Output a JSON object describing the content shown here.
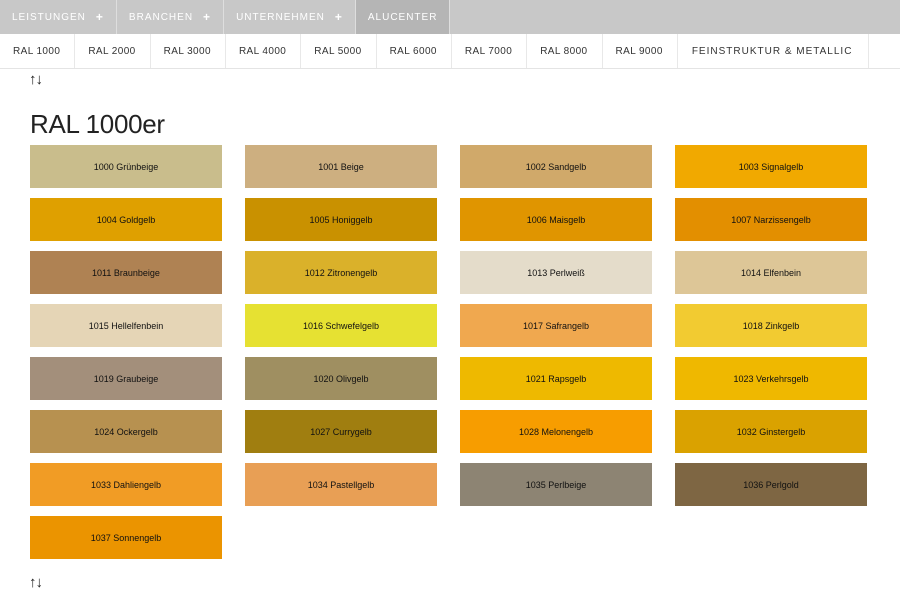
{
  "topnav": [
    {
      "label": "LEISTUNGEN",
      "has_plus": true
    },
    {
      "label": "BRANCHEN",
      "has_plus": true
    },
    {
      "label": "UNTERNEHMEN",
      "has_plus": true
    },
    {
      "label": "ALUCENTER",
      "has_plus": false
    }
  ],
  "plus_symbol": "+",
  "subnav": [
    "RAL 1000",
    "RAL 2000",
    "RAL 3000",
    "RAL 4000",
    "RAL 5000",
    "RAL 6000",
    "RAL 7000",
    "RAL 8000",
    "RAL 9000",
    "FEINSTRUKTUR & METALLIC"
  ],
  "arrows_text": "↑↓",
  "section_title": "RAL 1000er",
  "swatches": [
    {
      "label": "1000 Grünbeige",
      "color": "#C9BD8C"
    },
    {
      "label": "1001 Beige",
      "color": "#CDAF80"
    },
    {
      "label": "1002 Sandgelb",
      "color": "#D0A96A"
    },
    {
      "label": "1003 Signalgelb",
      "color": "#F1A900"
    },
    {
      "label": "1004 Goldgelb",
      "color": "#DFA000"
    },
    {
      "label": "1005 Honiggelb",
      "color": "#C99100"
    },
    {
      "label": "1006 Maisgelb",
      "color": "#E09500"
    },
    {
      "label": "1007 Narzissengelb",
      "color": "#E38F00"
    },
    {
      "label": "1011 Braunbeige",
      "color": "#AF8253"
    },
    {
      "label": "1012 Zitronengelb",
      "color": "#DAB12A"
    },
    {
      "label": "1013 Perlweiß",
      "color": "#E4DCCA"
    },
    {
      "label": "1014 Elfenbein",
      "color": "#DDC697"
    },
    {
      "label": "1015 Hellelfenbein",
      "color": "#E5D5B6"
    },
    {
      "label": "1016 Schwefelgelb",
      "color": "#E6E132"
    },
    {
      "label": "1017 Safrangelb",
      "color": "#F0A84F"
    },
    {
      "label": "1018 Zinkgelb",
      "color": "#F2CB31"
    },
    {
      "label": "1019 Graubeige",
      "color": "#A38F7B"
    },
    {
      "label": "1020 Olivgelb",
      "color": "#9F8F61"
    },
    {
      "label": "1021 Rapsgelb",
      "color": "#EEB900"
    },
    {
      "label": "1023 Verkehrsgelb",
      "color": "#EFB800"
    },
    {
      "label": "1024 Ockergelb",
      "color": "#B79150"
    },
    {
      "label": "1027 Currygelb",
      "color": "#A07E10"
    },
    {
      "label": "1028 Melonengelb",
      "color": "#F79D00"
    },
    {
      "label": "1032 Ginstergelb",
      "color": "#DAA200"
    },
    {
      "label": "1033 Dahliengelb",
      "color": "#F19C25"
    },
    {
      "label": "1034 Pastellgelb",
      "color": "#E89F55"
    },
    {
      "label": "1035 Perlbeige",
      "color": "#8D8473"
    },
    {
      "label": "1036 Perlgold",
      "color": "#7E6643"
    },
    {
      "label": "1037 Sonnengelb",
      "color": "#EB9400"
    }
  ]
}
